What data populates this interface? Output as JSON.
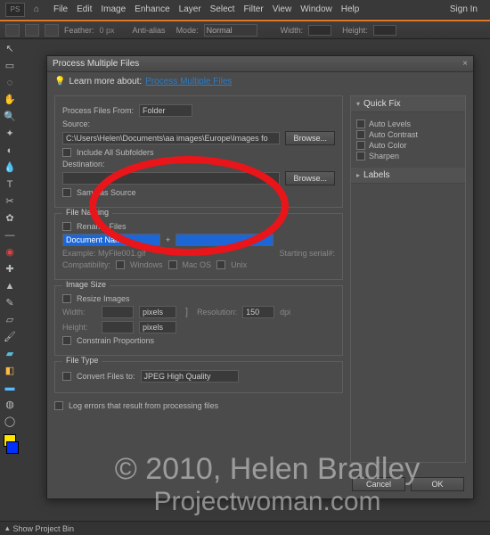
{
  "menubar": {
    "signin": "Sign In",
    "items": [
      "File",
      "Edit",
      "Image",
      "Enhance",
      "Layer",
      "Select",
      "Filter",
      "View",
      "Window",
      "Help"
    ]
  },
  "optbar": {
    "feather": "Feather:",
    "feather_val": "0 px",
    "antialias": "Anti-alias",
    "mode": "Mode:",
    "mode_val": "Normal",
    "width": "Width:",
    "height": "Height:"
  },
  "dialog": {
    "title": "Process Multiple Files",
    "tip": "Learn more about:",
    "tip_link": "Process Multiple Files",
    "proc_from": "Process Files From:",
    "proc_from_val": "Folder",
    "source": "Source:",
    "source_val": "C:\\Users\\Helen\\Documents\\aa images\\Europe\\Images fo",
    "browse": "Browse...",
    "include_sub": "Include All Subfolders",
    "dest": "Destination:",
    "same": "Same as Source",
    "naming": {
      "legend": "File Naming",
      "rename": "Rename Files",
      "seg1": "Document Name",
      "plus": "+",
      "seg2": "",
      "example": "Example: MyFile001.gif",
      "start": "Starting serial#:",
      "compat": "Compatibility:",
      "win": "Windows",
      "mac": "Mac OS",
      "unix": "Unix"
    },
    "size": {
      "legend": "Image Size",
      "resize": "Resize Images",
      "width": "Width:",
      "height": "Height:",
      "unit": "pixels",
      "res": "Resolution:",
      "res_val": "150",
      "dpi": "dpi",
      "constrain": "Constrain Proportions"
    },
    "type": {
      "legend": "File Type",
      "convert": "Convert Files to:",
      "format": "JPEG High Quality"
    },
    "log": "Log errors that result from processing files",
    "quick": {
      "head": "Quick Fix",
      "items": [
        "Auto Levels",
        "Auto Contrast",
        "Auto Color",
        "Sharpen"
      ]
    },
    "labels": {
      "head": "Labels"
    },
    "cancel": "Cancel",
    "ok": "OK"
  },
  "projbin": "Show Project Bin",
  "watermark": {
    "l1": "© 2010, Helen Bradley",
    "l2": "Projectwoman.com"
  },
  "tools": [
    "move",
    "marquee",
    "lasso",
    "hand",
    "zoom",
    "wand",
    "quick-sel",
    "eyedropper",
    "crop",
    "type",
    "cookie",
    "brush",
    "heal",
    "stamp",
    "redeye",
    "pencil",
    "eraser",
    "bucket",
    "gradient",
    "shape",
    "sponge",
    "blur",
    "custom"
  ]
}
